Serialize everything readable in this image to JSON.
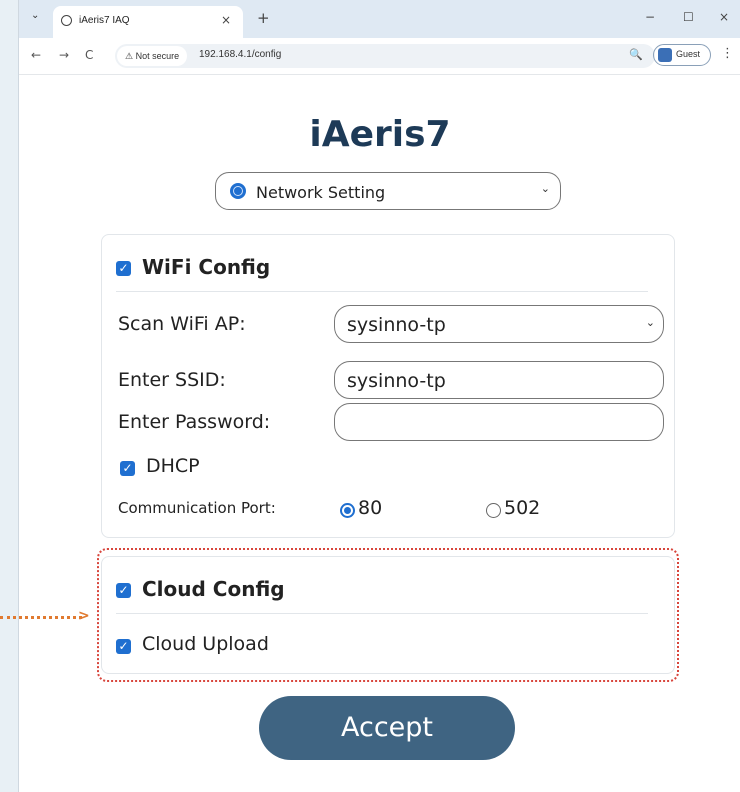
{
  "browser": {
    "tab_title": "iAeris7 IAQ",
    "tab_close": "×",
    "new_tab": "+",
    "menu": "⌄",
    "win_min": "−",
    "win_max": "☐",
    "win_close": "×",
    "back": "←",
    "forward": "→",
    "reload": "C",
    "security_label": "⚠ Not secure",
    "url": "192.168.4.1/config",
    "zoom_icon": "🔍",
    "profile_label": "Guest",
    "more": "⋮"
  },
  "page": {
    "title": "iAeris7",
    "mode_select": "Network Setting",
    "chevron": "⌄"
  },
  "wifi": {
    "heading": "WiFi Config",
    "checked": true,
    "scan_label": "Scan WiFi AP:",
    "scan_value": "sysinno-tp",
    "ssid_label": "Enter SSID:",
    "ssid_value": "sysinno-tp",
    "password_label": "Enter Password:",
    "password_value": "",
    "dhcp_label": "DHCP",
    "dhcp_checked": true,
    "port_label": "Communication Port:",
    "port_options": [
      "80",
      "502"
    ],
    "port_selected": "80"
  },
  "cloud": {
    "heading": "Cloud Config",
    "checked": true,
    "upload_label": "Cloud Upload",
    "upload_checked": true
  },
  "actions": {
    "accept": "Accept"
  },
  "colors": {
    "title": "#1d3a57",
    "checkbox": "#1f6fd0",
    "accept_bg": "#3f6482",
    "highlight_border": "#d8463d",
    "arrow": "#e07a30"
  }
}
